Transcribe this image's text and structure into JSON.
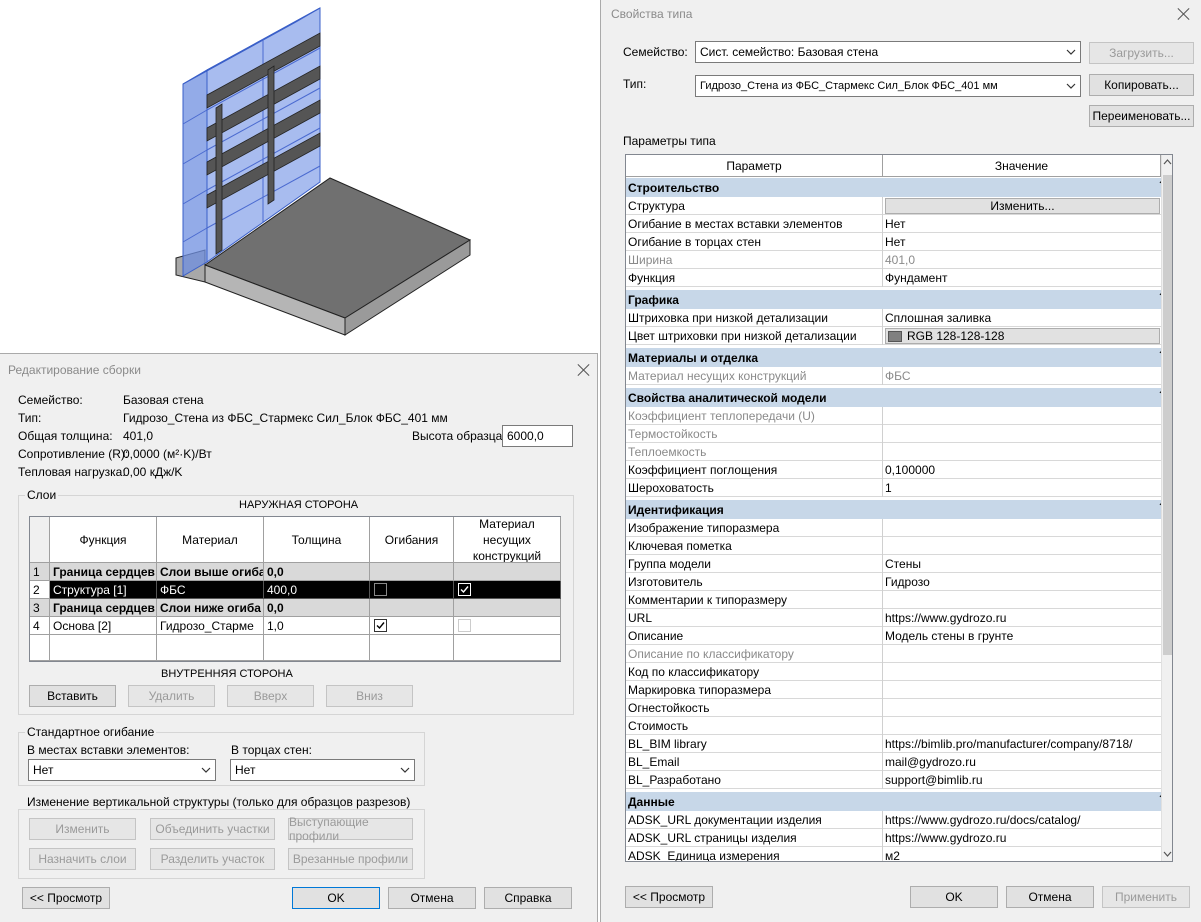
{
  "type_dialog": {
    "title": "Свойства типа",
    "family_label": "Семейство:",
    "family_value": "Сист. семейство: Базовая стена",
    "type_label": "Тип:",
    "type_value": "Гидрозо_Стена из ФБС_Стармекс Сил_Блок ФБС_401 мм",
    "load_button": "Загрузить...",
    "copy_button": "Копировать...",
    "rename_button": "Переименовать...",
    "params_label": "Параметры типа",
    "col_param": "Параметр",
    "col_value": "Значение",
    "col_eq": "=",
    "groups": {
      "construction": "Строительство",
      "graphics": "Графика",
      "materials": "Материалы и отделка",
      "analytic": "Свойства аналитической модели",
      "identity": "Идентификация",
      "data": "Данные"
    },
    "rows": {
      "structure": {
        "name": "Структура",
        "button": "Изменить..."
      },
      "wrap_inserts": {
        "name": "Огибание в местах вставки элементов",
        "value": "Нет"
      },
      "wrap_ends": {
        "name": "Огибание в торцах стен",
        "value": "Нет"
      },
      "width": {
        "name": "Ширина",
        "value": "401,0"
      },
      "function": {
        "name": "Функция",
        "value": "Фундамент"
      },
      "coarse_fill": {
        "name": "Штриховка при низкой детализации",
        "value": "Сплошная заливка"
      },
      "coarse_color": {
        "name": "Цвет штриховки при низкой детализации",
        "value": "RGB 128-128-128",
        "swatch": "#808080"
      },
      "struct_material": {
        "name": "Материал несущих конструкций",
        "value": "ФБС"
      },
      "heat_coef": {
        "name": "Коэффициент теплопередачи (U)",
        "value": ""
      },
      "thermal_res": {
        "name": "Термостойкость",
        "value": ""
      },
      "thermal_mass": {
        "name": "Теплоемкость",
        "value": ""
      },
      "absorptance": {
        "name": "Коэффициент поглощения",
        "value": "0,100000"
      },
      "roughness": {
        "name": "Шероховатость",
        "value": "1"
      },
      "type_image": {
        "name": "Изображение типоразмера",
        "value": ""
      },
      "keynote": {
        "name": "Ключевая пометка",
        "value": ""
      },
      "model_group": {
        "name": "Группа модели",
        "value": "Стены"
      },
      "manufacturer": {
        "name": "Изготовитель",
        "value": "Гидрозо"
      },
      "type_comments": {
        "name": "Комментарии к типоразмеру",
        "value": ""
      },
      "url": {
        "name": "URL",
        "value": "https://www.gydrozo.ru"
      },
      "description": {
        "name": "Описание",
        "value": "Модель стены в грунте"
      },
      "class_description": {
        "name": "Описание по классификатору",
        "value": ""
      },
      "class_code": {
        "name": "Код по классификатору",
        "value": ""
      },
      "type_mark": {
        "name": "Маркировка типоразмера",
        "value": ""
      },
      "fire_rating": {
        "name": "Огнестойкость",
        "value": ""
      },
      "cost": {
        "name": "Стоимость",
        "value": ""
      },
      "bl_bim": {
        "name": "BL_BIM library",
        "value": "https://bimlib.pro/manufacturer/company/8718/"
      },
      "bl_email": {
        "name": "BL_Email",
        "value": "mail@gydrozo.ru"
      },
      "bl_dev": {
        "name": "BL_Разработано",
        "value": "support@bimlib.ru"
      },
      "adsk_doc": {
        "name": "ADSK_URL документации изделия",
        "value": "https://www.gydrozo.ru/docs/catalog/"
      },
      "adsk_page": {
        "name": "ADSK_URL страницы изделия",
        "value": "https://www.gydrozo.ru"
      },
      "adsk_unit": {
        "name": "ADSK_Единица измерения",
        "value": "м2"
      }
    },
    "preview_button": "<< Просмотр",
    "ok_button": "OK",
    "cancel_button": "Отмена",
    "apply_button": "Применить"
  },
  "assembly_dialog": {
    "title": "Редактирование сборки",
    "family_label": "Семейство:",
    "family_value": "Базовая стена",
    "type_label": "Тип:",
    "type_value": "Гидрозо_Стена из ФБС_Стармекс Сил_Блок ФБС_401 мм",
    "thickness_label": "Общая толщина:",
    "thickness_value": "401,0",
    "sample_height_label": "Высота образца:",
    "sample_height_value": "6000,0",
    "resistance_label": "Сопротивление (R):",
    "resistance_value": "0,0000 (м²·K)/Вт",
    "thermal_mass_label": "Тепловая нагрузка:",
    "thermal_mass_value": "0,00 кДж/K",
    "layers_legend": "Слои",
    "exterior_side": "НАРУЖНАЯ СТОРОНА",
    "interior_side": "ВНУТРЕННЯЯ СТОРОНА",
    "columns": [
      "Функция",
      "Материал",
      "Толщина",
      "Огибания",
      "Материал несущих конструкций"
    ],
    "layers": [
      {
        "num": "1",
        "function": "Граница сердцев",
        "material": "Слои выше огиба",
        "thickness": "0,0",
        "wrap": false,
        "structural": false
      },
      {
        "num": "2",
        "function": "Структура [1]",
        "material": "ФБС",
        "thickness": "400,0",
        "wrap": false,
        "structural": true
      },
      {
        "num": "3",
        "function": "Граница сердцев",
        "material": "Слои ниже огиба",
        "thickness": "0,0",
        "wrap": false,
        "structural": false
      },
      {
        "num": "4",
        "function": "Основа [2]",
        "material": "Гидрозо_Старме",
        "thickness": "1,0",
        "wrap": true,
        "structural": false
      }
    ],
    "insert_button": "Вставить",
    "delete_button": "Удалить",
    "up_button": "Вверх",
    "down_button": "Вниз",
    "default_wrap_legend": "Стандартное огибание",
    "at_inserts_label": "В местах вставки элементов:",
    "at_inserts_value": "Нет",
    "at_ends_label": "В торцах стен:",
    "at_ends_value": "Нет",
    "vertical_legend": "Изменение вертикальной структуры (только для образцов разрезов)",
    "modify_button": "Изменить",
    "merge_button": "Объединить участки",
    "sweeps_button": "Выступающие профили",
    "assign_button": "Назначить слои",
    "split_button": "Разделить участок",
    "reveals_button": "Врезанные профили",
    "preview_button": "<< Просмотр",
    "ok_button": "OK",
    "cancel_button": "Отмена",
    "help_button": "Справка"
  }
}
